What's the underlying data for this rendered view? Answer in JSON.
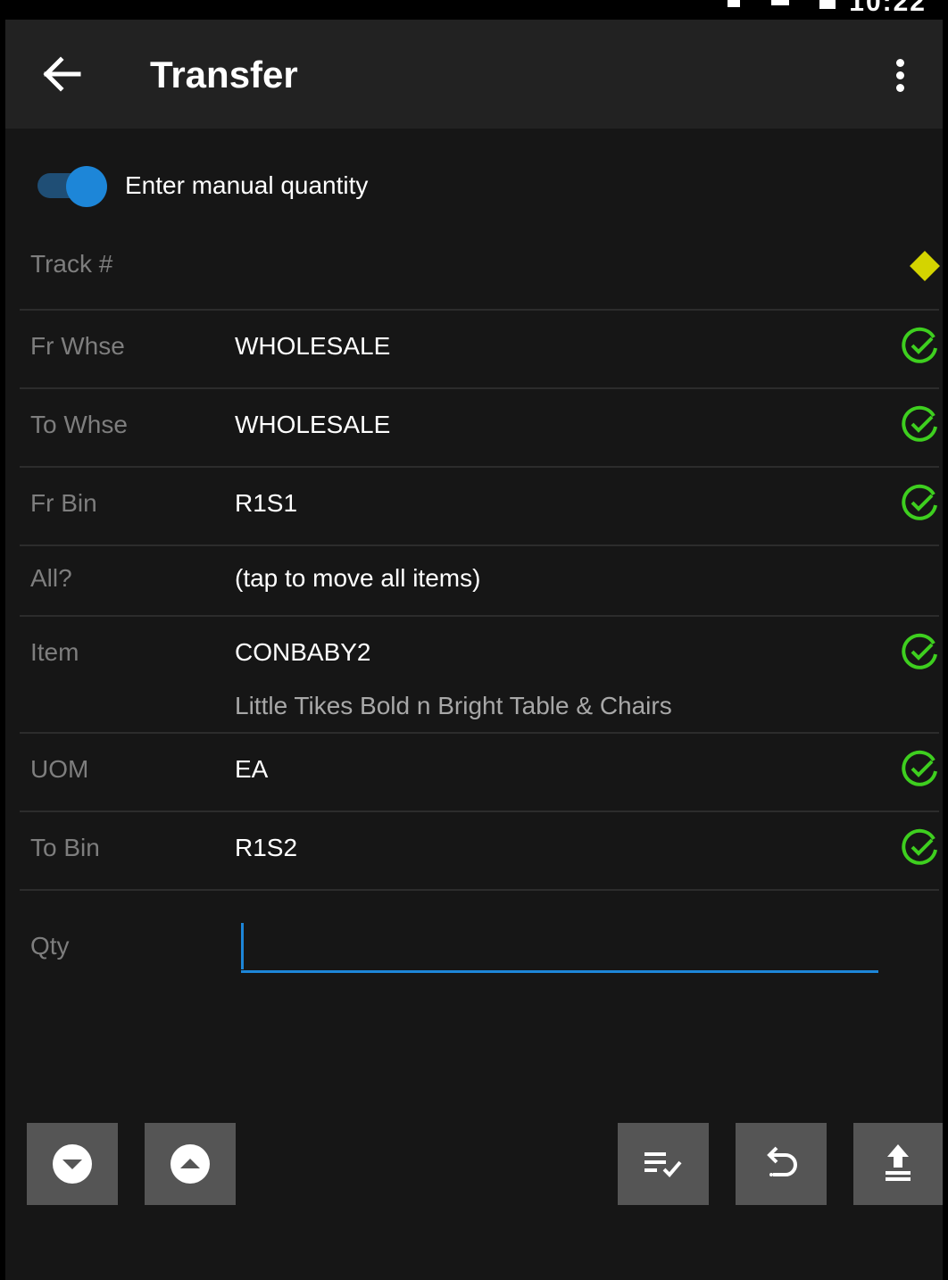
{
  "status_bar": {
    "time": "10:22"
  },
  "app_bar": {
    "title": "Transfer",
    "back_icon": "arrow-back-icon",
    "menu_icon": "more-vert-icon"
  },
  "manual_qty": {
    "label": "Enter manual quantity",
    "enabled": true
  },
  "fields": [
    {
      "label": "Track #",
      "value": "",
      "status": "required-diamond"
    },
    {
      "label": "Fr Whse",
      "value": "WHOLESALE",
      "status": "check"
    },
    {
      "label": "To Whse",
      "value": "WHOLESALE",
      "status": "check"
    },
    {
      "label": "Fr Bin",
      "value": "R1S1",
      "status": "check"
    },
    {
      "label": "All?",
      "value": "(tap to move all items)",
      "status": "none"
    },
    {
      "label": "Item",
      "value": "CONBABY2",
      "description": "Little Tikes Bold n Bright Table & Chairs",
      "status": "check"
    },
    {
      "label": "UOM",
      "value": "EA",
      "status": "check"
    },
    {
      "label": "To Bin",
      "value": "R1S2",
      "status": "check"
    }
  ],
  "qty": {
    "label": "Qty",
    "value": ""
  },
  "buttons": {
    "next": "chevron-down-circle-icon",
    "previous": "chevron-up-circle-icon",
    "review": "playlist-check-icon",
    "undo": "undo-icon",
    "upload": "upload-icon"
  },
  "colors": {
    "accent": "#1d86d8",
    "check": "#3ecf1f",
    "required": "#d4d400",
    "background": "#161616",
    "app_bar": "#222222",
    "button": "#555555"
  }
}
